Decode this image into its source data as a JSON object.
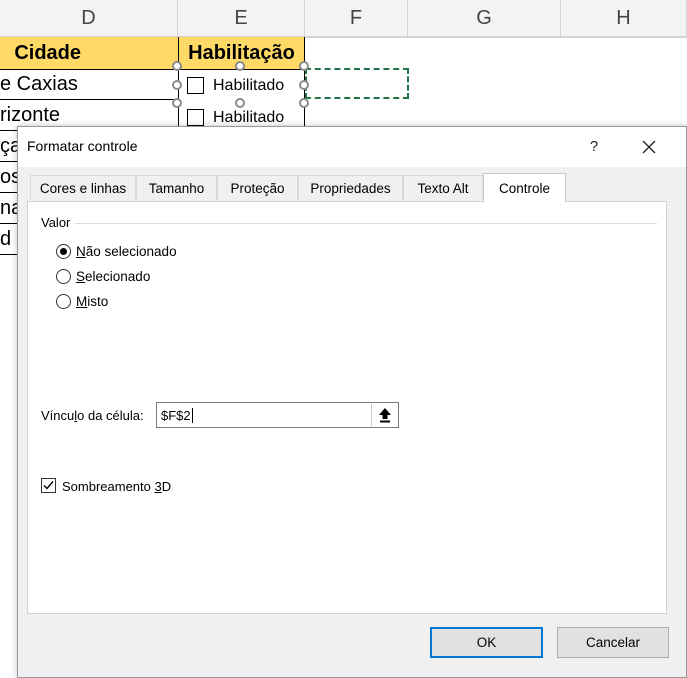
{
  "sheet": {
    "columns": [
      "D",
      "E",
      "F",
      "G",
      "H"
    ],
    "header_cells": {
      "city": "Cidade",
      "license": "Habilitação"
    },
    "rows": [
      "e Caxias",
      "rizonte",
      "ça",
      "os",
      "na",
      "d"
    ],
    "checkbox_label": "Habilitado"
  },
  "dialog": {
    "title": "Formatar controle",
    "help": "?",
    "tabs": [
      "Cores e linhas",
      "Tamanho",
      "Proteção",
      "Propriedades",
      "Texto Alt",
      "Controle"
    ],
    "active_tab": "Controle",
    "value_group": "Valor",
    "options": [
      {
        "first": "N",
        "rest": "ão selecionado",
        "selected": true
      },
      {
        "first": "S",
        "rest": "elecionado",
        "selected": false
      },
      {
        "first": "M",
        "rest": "isto",
        "selected": false
      }
    ],
    "cell_link": {
      "label_before": "Víncu",
      "label_u": "l",
      "label_after": "o da célula:",
      "value": "$F$2"
    },
    "shading": {
      "label_before": "Sombreamento ",
      "label_u": "3",
      "label_after": "D",
      "checked": true
    },
    "ok": "OK",
    "cancel": "Cancelar"
  },
  "colors": {
    "header_yellow": "#ffd966",
    "accent": "#0078d7",
    "dashed_border": "#217346"
  }
}
